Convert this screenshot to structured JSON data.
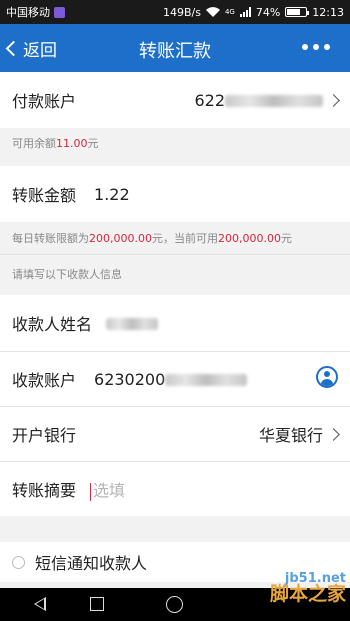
{
  "status_bar": {
    "carrier": "中国移动",
    "speed": "149B/s",
    "network": "4G",
    "battery_percent": "74%",
    "battery_level": 0.74,
    "time": "12:13"
  },
  "nav": {
    "back_label": "返回",
    "title": "转账汇款"
  },
  "payer": {
    "label": "付款账户",
    "account_prefix": "622"
  },
  "balance_note": {
    "prefix": "可用余额",
    "amount": "11.00",
    "suffix": "元"
  },
  "amount": {
    "label": "转账金额",
    "value": "1.22"
  },
  "limit_note": {
    "p1": "每日转账限额为",
    "v1": "200,000.00",
    "p2": "元，当前可用",
    "v2": "200,000.00",
    "p3": "元"
  },
  "payee_hint": "请填写以下收款人信息",
  "payee_name": {
    "label": "收款人姓名"
  },
  "payee_account": {
    "label": "收款账户",
    "account_prefix": "6230200"
  },
  "bank": {
    "label": "开户银行",
    "value": "华夏银行"
  },
  "memo": {
    "label": "转账摘要",
    "placeholder": "选填"
  },
  "sms": {
    "label": "短信通知收款人"
  },
  "watermark": {
    "site": "jb51.net",
    "name": "脚本之家"
  },
  "colors": {
    "nav_blue": "#1e6fc9",
    "amount_red": "#d7263d"
  }
}
